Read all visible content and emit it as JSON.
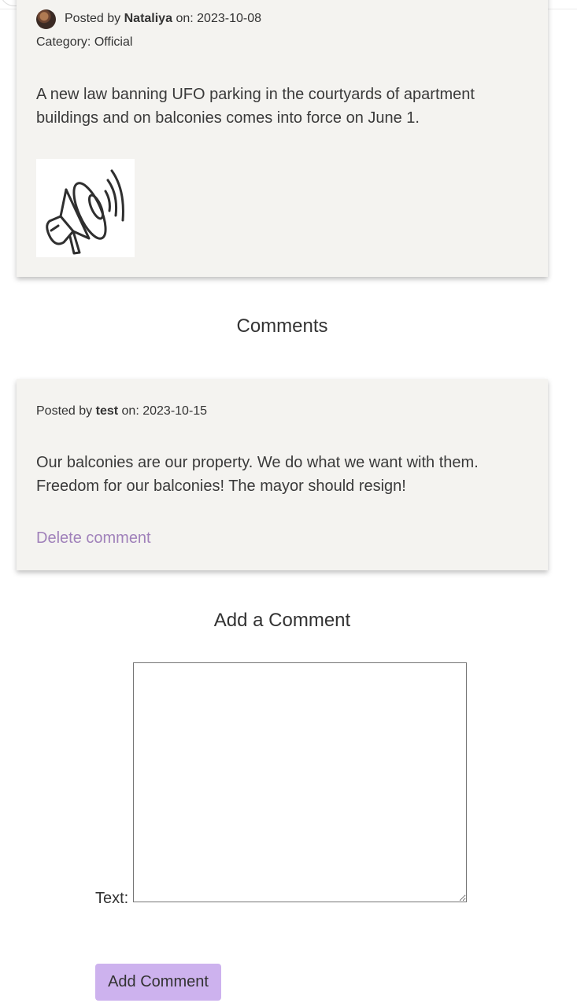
{
  "post": {
    "posted_by_prefix": "Posted by",
    "author": "Nataliya",
    "on_label": "on:",
    "date": "2023-10-08",
    "category_label": "Category:",
    "category": "Official",
    "body": "A new law banning UFO parking in the courtyards of apartment buildings and on balconies comes into force on June 1.",
    "image_icon": "megaphone-icon"
  },
  "comments_section": {
    "heading": "Comments",
    "items": [
      {
        "posted_by_prefix": "Posted by",
        "author": "test",
        "on_label": "on:",
        "date": "2023-10-15",
        "body": "Our balconies are our property. We do what we want with them. Freedom for our balconies! The mayor should resign!",
        "delete_label": "Delete comment"
      }
    ]
  },
  "comment_form": {
    "heading": "Add a Comment",
    "text_label": "Text:",
    "textarea_value": "",
    "submit_label": "Add Comment"
  },
  "colors": {
    "card_background": "#f4f3f0",
    "link": "#a081ba",
    "button": "#cdb2ee"
  }
}
